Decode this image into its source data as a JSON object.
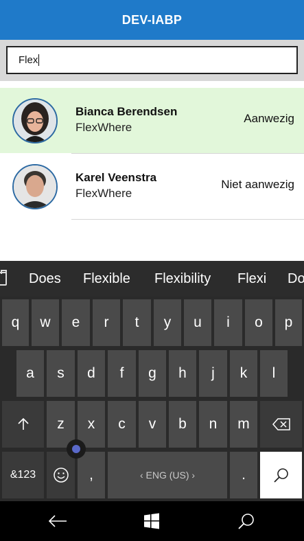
{
  "header": {
    "title": "DEV-IABP"
  },
  "search": {
    "value": "Flex"
  },
  "people": [
    {
      "name": "Bianca Berendsen",
      "company": "FlexWhere",
      "status": "Aanwezig",
      "selected": true
    },
    {
      "name": "Karel Veenstra",
      "company": "FlexWhere",
      "status": "Niet aanwezig",
      "selected": false
    }
  ],
  "keyboard": {
    "suggestions": [
      "Does",
      "Flexible",
      "Flexibility",
      "Flexi",
      "Do"
    ],
    "row1": [
      "q",
      "w",
      "e",
      "r",
      "t",
      "y",
      "u",
      "i",
      "o",
      "p"
    ],
    "row2": [
      "a",
      "s",
      "d",
      "f",
      "g",
      "h",
      "j",
      "k",
      "l"
    ],
    "row3": [
      "z",
      "x",
      "c",
      "v",
      "b",
      "n",
      "m"
    ],
    "symbols_label": "&123",
    "comma": ",",
    "period": ".",
    "space_label": "ENG (US)"
  },
  "colors": {
    "header": "#1f7ac9",
    "selected_row": "#e2f7da",
    "keyboard": "#2a2a2a"
  }
}
